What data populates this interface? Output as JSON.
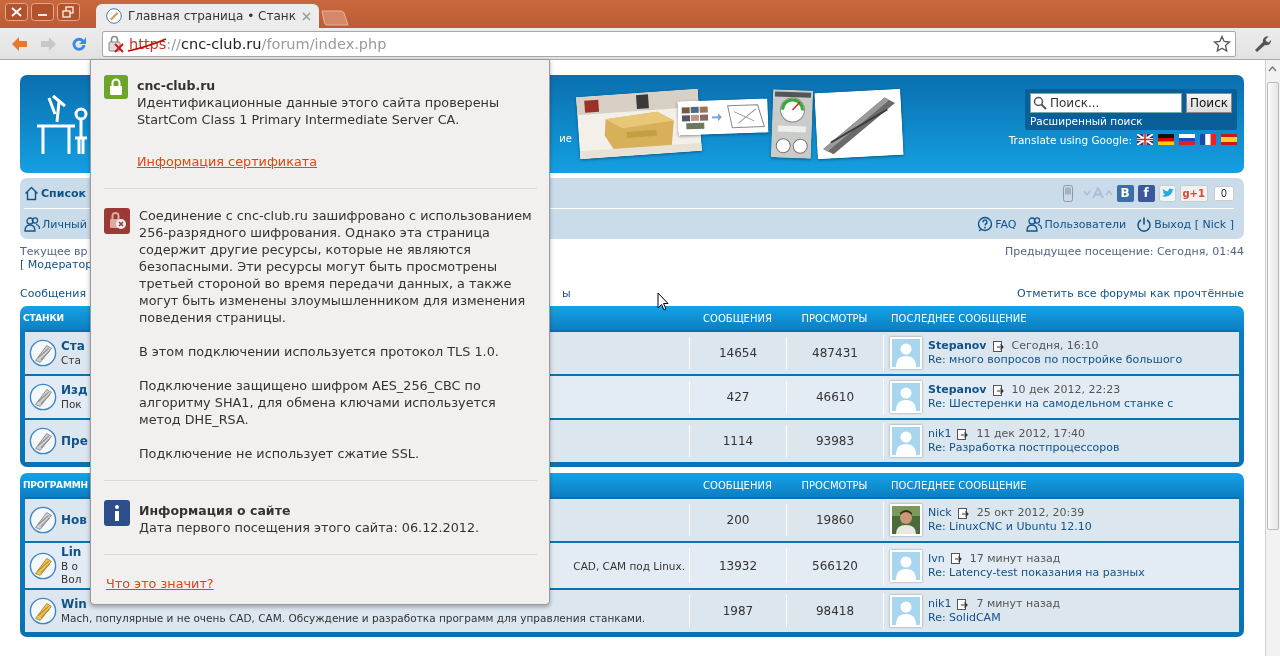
{
  "browser": {
    "tabs": [
      {
        "title": "Главная страница • Станк",
        "selected": true
      }
    ],
    "nav_buttons": [
      {
        "kind": "back",
        "disabled": false
      },
      {
        "kind": "forward",
        "disabled": true
      },
      {
        "kind": "reload",
        "disabled": false
      }
    ],
    "address": {
      "scheme": "https",
      "separator": "://",
      "host": "cnc-club.ru",
      "path": "/forum/index.php",
      "insecure": true
    }
  },
  "header": {
    "tagline_fragment": "ие",
    "search": {
      "placeholder": "Поиск...",
      "button": "Поиск",
      "advanced_link": "Расширенный поиск"
    },
    "translate_label": "Translate using Google:"
  },
  "nav": {
    "home_link": "Список",
    "user_link": "Личный",
    "social": [
      {
        "kind": "vk",
        "label": "B"
      },
      {
        "kind": "facebook",
        "label": "f"
      },
      {
        "kind": "twitter"
      },
      {
        "kind": "gplus",
        "label": "g+1"
      }
    ],
    "share_count": "0",
    "links": [
      {
        "kind": "faq",
        "label": "FAQ"
      },
      {
        "kind": "users",
        "label": "Пользователи"
      },
      {
        "kind": "logout",
        "label": "Выход [ Nick ]"
      }
    ]
  },
  "info": {
    "current_time": "Текущее вр",
    "previous_visit": "Предыдущее посещение: Сегодня, 01:44",
    "moderator": "[ Модератор"
  },
  "actions": {
    "posts_link": "Сообщения",
    "fragment": "ы",
    "mark_read": "Отметить все форумы как прочтённые"
  },
  "sections": [
    {
      "title": "СТАНКИ",
      "columns": [
        "СООБЩЕНИЯ",
        "ПРОСМОТРЫ",
        "ПОСЛЕДНЕЕ СООБЩЕНИЕ"
      ],
      "forums": [
        {
          "title": "Ста",
          "description": [
            "Ста"
          ],
          "unread": false,
          "posts": "14654",
          "views": "487431",
          "last": {
            "author": "Stepanov",
            "author_bold": true,
            "photo": false,
            "time": "Сегодня, 16:10",
            "topic": "Re: много вопросов по постройке большого"
          }
        },
        {
          "title": "Изд",
          "description": [
            "Пок"
          ],
          "unread": false,
          "posts": "427",
          "views": "46610",
          "last": {
            "author": "Stepanov",
            "author_bold": true,
            "photo": false,
            "time": "10 дек 2012, 22:23",
            "topic": "Re: Шестеренки на самодельном станке с"
          }
        },
        {
          "title": "Пре",
          "unread": false,
          "posts": "1114",
          "views": "93983",
          "last": {
            "author": "nik1",
            "author_bold": false,
            "photo": false,
            "time": "11 дек 2012, 17:40",
            "topic": "Re: Разработка постпроцессоров"
          }
        }
      ]
    },
    {
      "title": "ПРОГРАММН",
      "columns": [
        "СООБЩЕНИЯ",
        "ПРОСМОТРЫ",
        "ПОСЛЕДНЕЕ СООБЩЕНИЕ"
      ],
      "forums": [
        {
          "title": "Нов",
          "unread": false,
          "posts": "200",
          "views": "19860",
          "last": {
            "author": "Nick",
            "author_bold": false,
            "photo": true,
            "time": "25 окт 2012, 20:39",
            "topic": "Re: LinuxCNC и Ubuntu 12.10"
          }
        },
        {
          "title": "Lin",
          "description": [
            "В о",
            "Вол"
          ],
          "description_tail": "CAD, CAM под Linux.",
          "unread": true,
          "posts": "13932",
          "views": "566120",
          "last": {
            "author": "Ivn",
            "author_bold": false,
            "photo": false,
            "time": "17 минут назад",
            "topic": "Re: Latency-test показания на разных"
          }
        },
        {
          "title": "Win",
          "description": [
            "Mach, популярные и не очень CAD, CAM. Обсуждение и разработка программ для управления станками."
          ],
          "unread": true,
          "posts": "1987",
          "views": "98418",
          "last": {
            "author": "nik1",
            "author_bold": false,
            "photo": false,
            "time": "7 минут назад",
            "topic": "Re: SolidCAM"
          }
        }
      ]
    }
  ],
  "site_popup": {
    "sections": [
      {
        "kind": "identity",
        "title": "cnc-club.ru",
        "paragraphs": [
          "Идентификационные данные этого сайта проверены StartCom Class 1 Primary Intermediate Server CA."
        ],
        "link": "Информация сертификата"
      },
      {
        "kind": "connection_warning",
        "paragraphs": [
          "Соединение с cnc-club.ru зашифровано с использованием 256-разрядного шифрования. Однако эта страница содержит другие ресурсы, которые не являются безопасными. Эти ресурсы могут быть просмотрены третьей стороной во время передачи данных, а также могут быть изменены злоумышленником для изменения поведения страницы.",
          "В этом подключении используется протокол TLS 1.0.",
          "Подключение защищено шифром AES_256_CBC по алгоритму SHA1, для обмена ключами используется метод DHE_RSA.",
          "Подключение не использует сжатие SSL."
        ]
      },
      {
        "kind": "site_info",
        "title": "Информация о сайте",
        "paragraphs": [
          "Дата первого посещения этого сайта: 06.12.2012."
        ]
      }
    ],
    "help_link": "Что это значит?"
  }
}
